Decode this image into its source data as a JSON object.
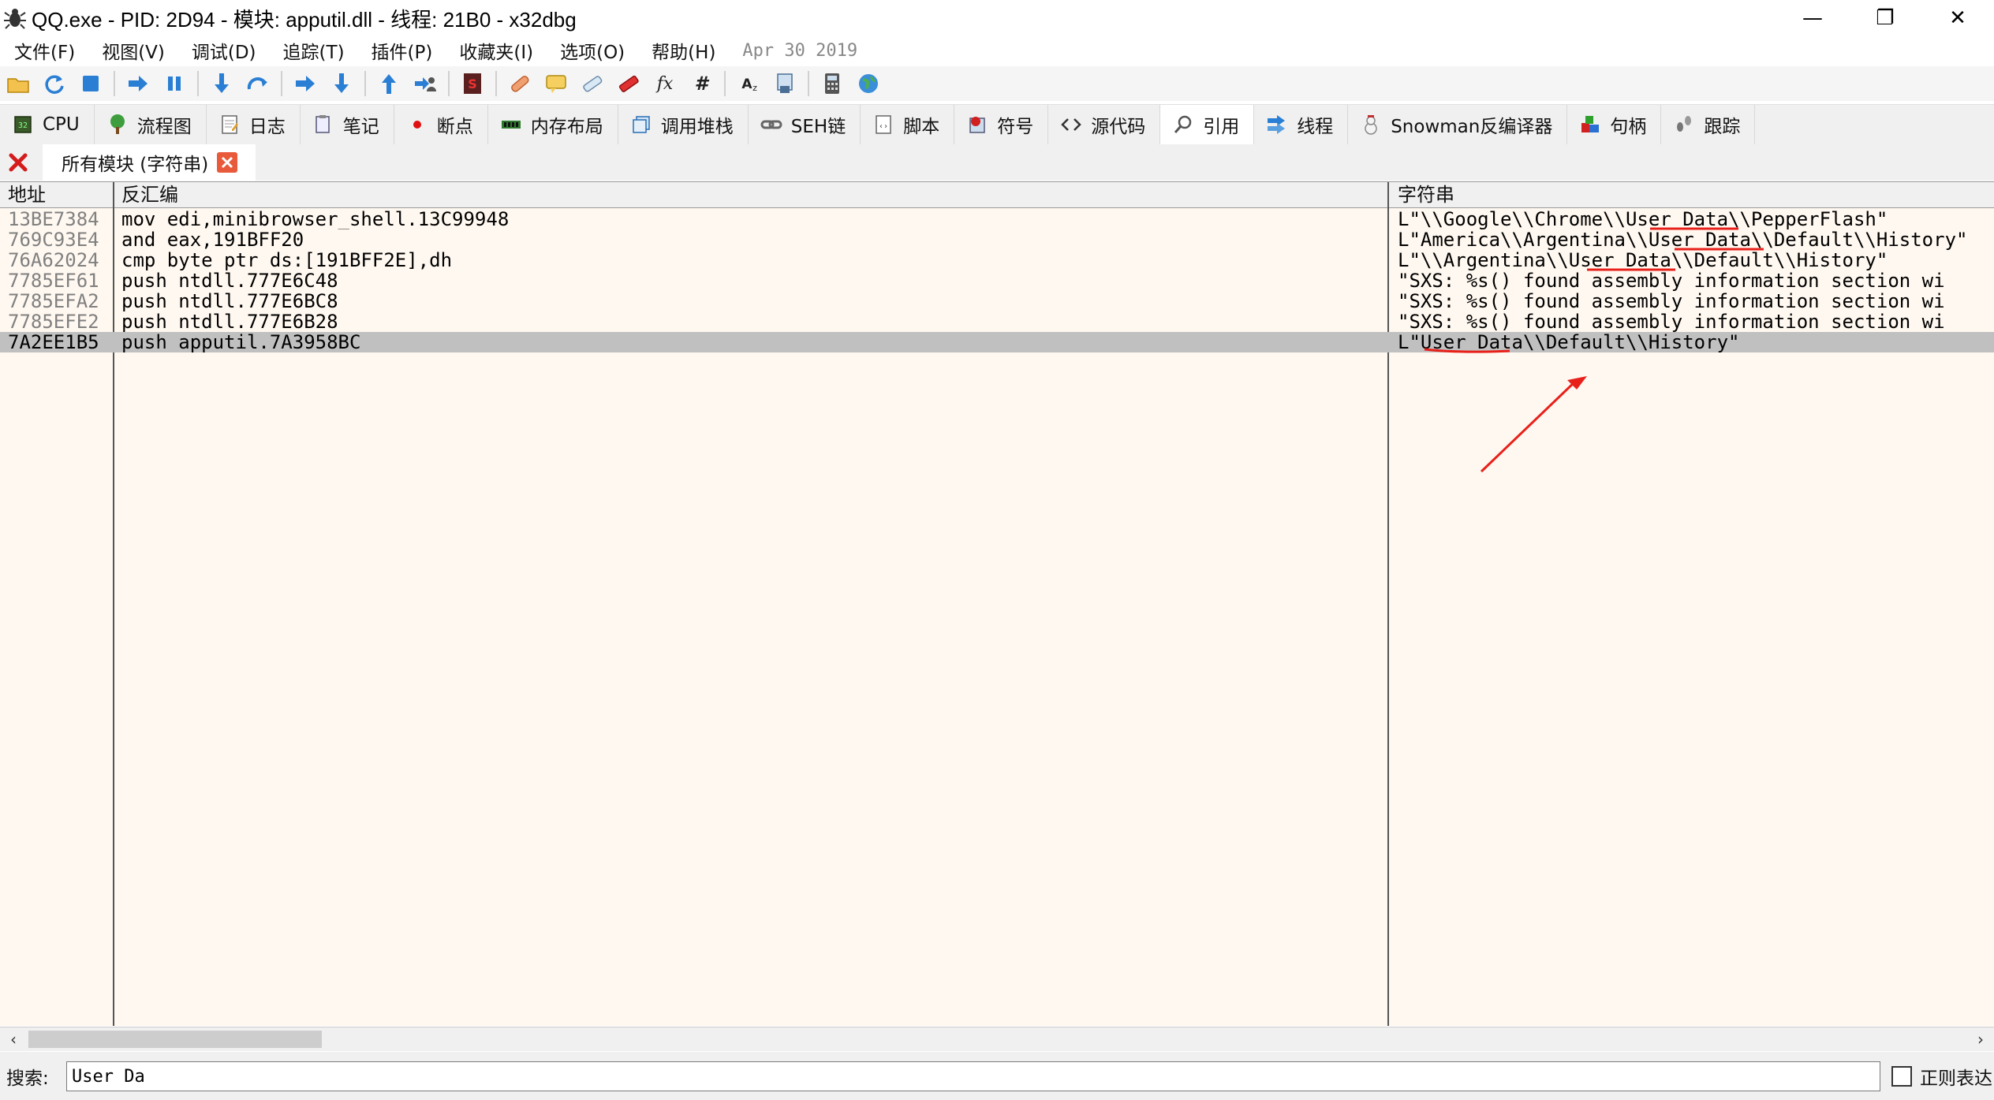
{
  "window": {
    "title": "QQ.exe - PID: 2D94 - 模块: apputil.dll - 线程: 21B0 - x32dbg",
    "minimize": "—",
    "restore": "❐",
    "close": "✕"
  },
  "menu": {
    "items": [
      "文件(F)",
      "视图(V)",
      "调试(D)",
      "追踪(T)",
      "插件(P)",
      "收藏夹(I)",
      "选项(O)",
      "帮助(H)"
    ],
    "build_date": "Apr 30 2019"
  },
  "toolbar": {
    "icons": [
      "open-icon",
      "restart-icon",
      "stop-icon",
      "run-icon",
      "pause-icon",
      "step-into-icon",
      "step-over-icon",
      "trace-into-icon",
      "trace-over-icon",
      "execute-till-return-icon",
      "run-to-user-code-icon",
      "scylla-icon",
      "patch-icon",
      "comments-icon",
      "labels-icon",
      "bookmarks-icon",
      "functions-icon",
      "hash-icon",
      "strings-icon",
      "module-icon",
      "calculator-icon",
      "globe-icon"
    ]
  },
  "tabs": [
    {
      "label": "CPU",
      "icon": "cpu-icon"
    },
    {
      "label": "流程图",
      "icon": "graph-icon"
    },
    {
      "label": "日志",
      "icon": "log-icon"
    },
    {
      "label": "笔记",
      "icon": "notes-icon"
    },
    {
      "label": "断点",
      "icon": "breakpoint-icon"
    },
    {
      "label": "内存布局",
      "icon": "memory-map-icon"
    },
    {
      "label": "调用堆栈",
      "icon": "call-stack-icon"
    },
    {
      "label": "SEH链",
      "icon": "seh-chain-icon"
    },
    {
      "label": "脚本",
      "icon": "script-icon"
    },
    {
      "label": "符号",
      "icon": "symbols-icon"
    },
    {
      "label": "源代码",
      "icon": "source-icon"
    },
    {
      "label": "引用",
      "icon": "references-icon",
      "active": true
    },
    {
      "label": "线程",
      "icon": "threads-icon"
    },
    {
      "label": "Snowman反编译器",
      "icon": "snowman-icon"
    },
    {
      "label": "句柄",
      "icon": "handles-icon"
    },
    {
      "label": "跟踪",
      "icon": "trace-icon"
    }
  ],
  "subtab": {
    "label": "所有模块 (字符串)"
  },
  "table": {
    "headers": {
      "address": "地址",
      "disassembly": "反汇编",
      "string": "字符串"
    },
    "rows": [
      {
        "address": "13BE7384",
        "disassembly": "mov edi,minibrowser_shell.13C99948",
        "string": "L\"\\\\Google\\\\Chrome\\\\User Data\\\\PepperFlash\""
      },
      {
        "address": "769C93E4",
        "disassembly": "and eax,191BFF20",
        "string": "L\"America\\\\Argentina\\\\User Data\\\\Default\\\\History\""
      },
      {
        "address": "76A62024",
        "disassembly": "cmp byte ptr ds:[191BFF2E],dh",
        "string": "L\"\\\\Argentina\\\\User Data\\\\Default\\\\History\""
      },
      {
        "address": "7785EF61",
        "disassembly": "push ntdll.777E6C48",
        "string": "\"SXS: %s() found assembly information section wi"
      },
      {
        "address": "7785EFA2",
        "disassembly": "push ntdll.777E6BC8",
        "string": "\"SXS: %s() found assembly information section wi"
      },
      {
        "address": "7785EFE2",
        "disassembly": "push ntdll.777E6B28",
        "string": "\"SXS: %s() found assembly information section wi"
      },
      {
        "address": "7A2EE1B5",
        "disassembly": "push apputil.7A3958BC",
        "string": "L\"User Data\\\\Default\\\\History\"",
        "selected": true
      }
    ]
  },
  "scrollbar": {
    "left_arrow": "‹",
    "right_arrow": "›"
  },
  "search": {
    "label": "搜索:",
    "value": "User Da",
    "regex_label": "正则表达"
  },
  "colors": {
    "table_bg": "#fff8f0",
    "selected_row": "#c0c0c0",
    "annotation_red": "#e8201a"
  }
}
